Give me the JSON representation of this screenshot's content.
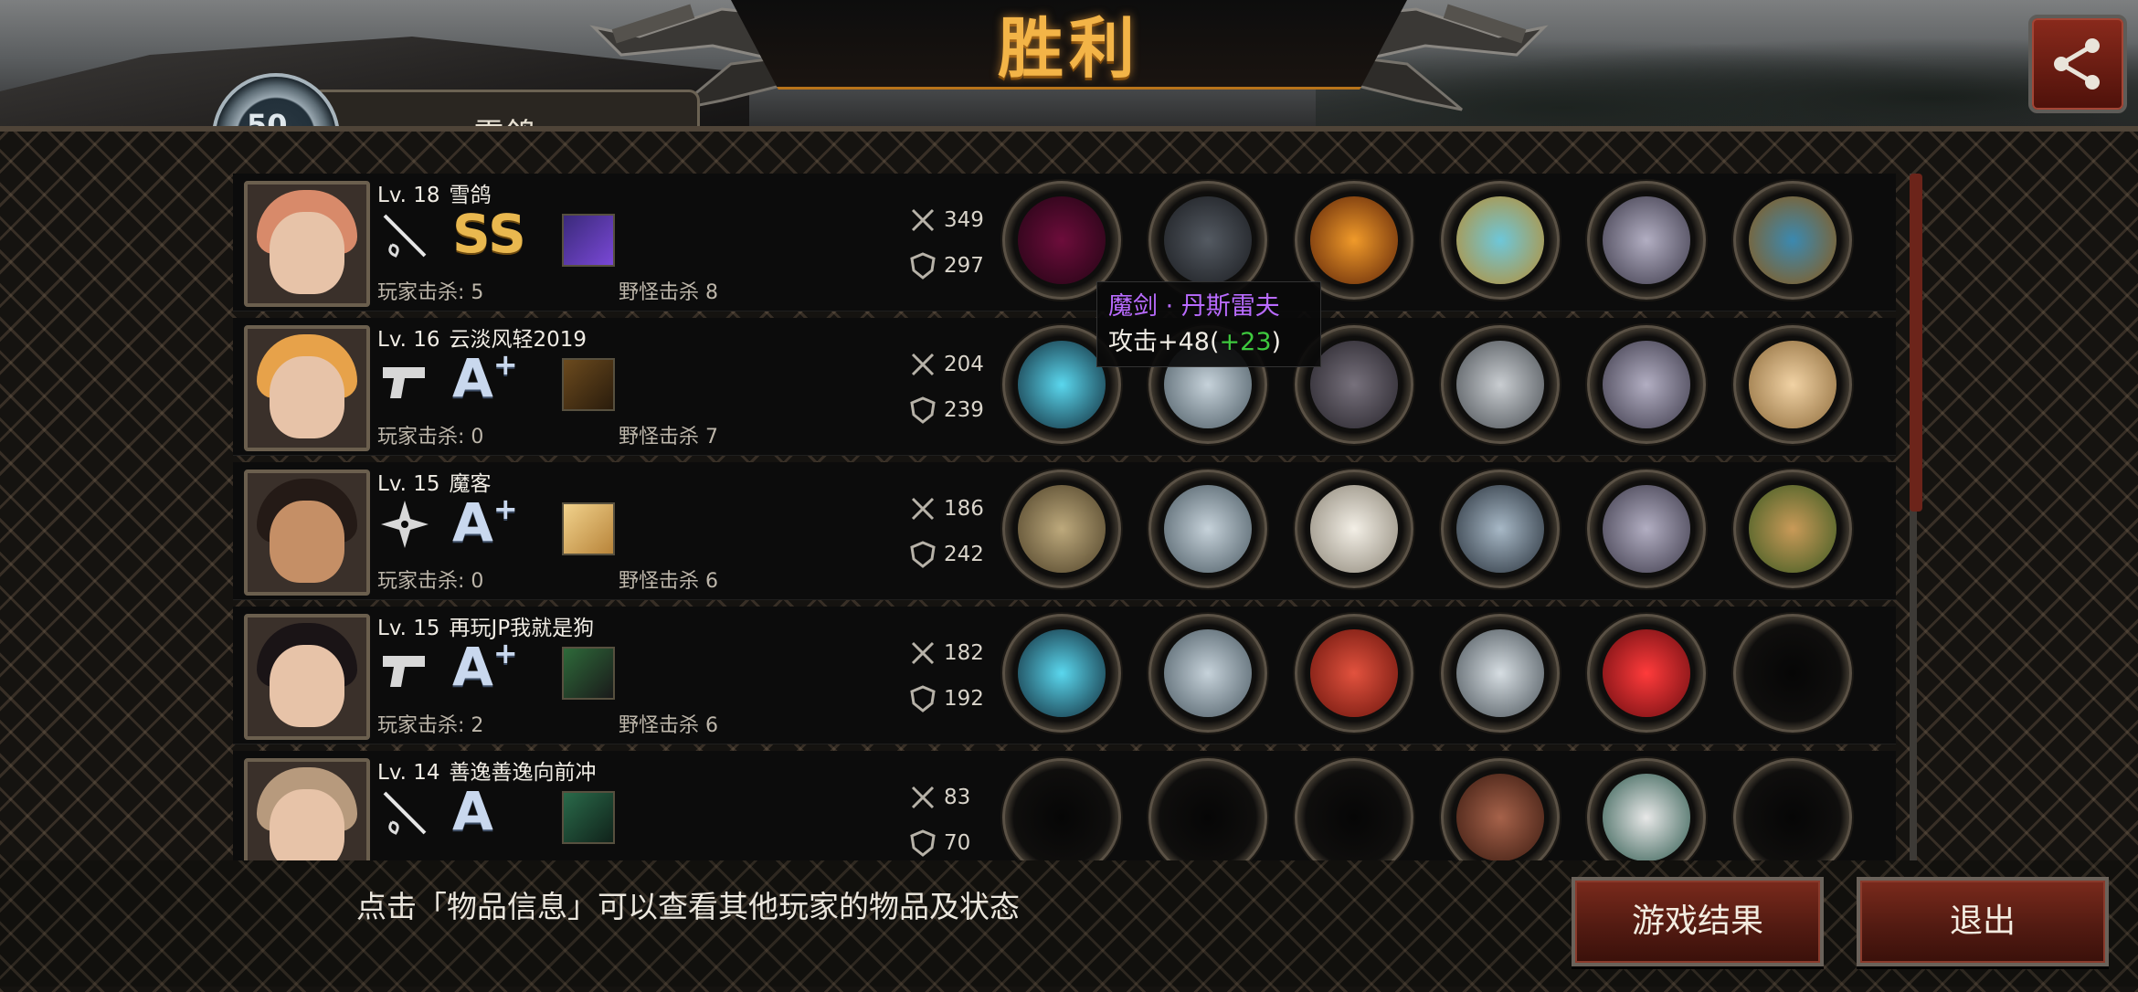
{
  "header": {
    "title": "胜利",
    "emblem_text": "50",
    "team_tab_text": "雪鸽"
  },
  "colors": {
    "title_gold": "#f3b447",
    "button_red": "#7a2a1c",
    "purple_item": "#b96bff",
    "green_bonus": "#3ec93e"
  },
  "players": [
    {
      "level": "Lv. 18",
      "name": "雪鸽",
      "weapon": "rapier-icon",
      "grade": "SS",
      "grade_sup": "",
      "player_kills": "玩家击杀: 5",
      "monster_kills": "野怪击杀 8",
      "attack": "349",
      "defense": "297",
      "items": [
        "magic-sword-icon",
        "dark-helmet-icon",
        "flame-armor-icon",
        "gold-bracelet-icon",
        "silver-boots-icon",
        "earrings-icon"
      ]
    },
    {
      "level": "Lv. 16",
      "name": "云淡风轻2019",
      "weapon": "pistol-icon",
      "grade": "A",
      "grade_sup": "+",
      "player_kills": "玩家击杀: 0",
      "monster_kills": "野怪击杀 7",
      "attack": "204",
      "defense": "239",
      "items": [
        "blue-rifle-icon",
        "steel-helmet-icon",
        "stone-armor-icon",
        "steel-disc-icon",
        "silver-boots-icon",
        "hand-fan-icon"
      ]
    },
    {
      "level": "Lv. 15",
      "name": "魔客",
      "weapon": "shuriken-icon",
      "grade": "A",
      "grade_sup": "+",
      "player_kills": "玩家击杀: 0",
      "monster_kills": "野怪击杀 6",
      "attack": "186",
      "defense": "242",
      "items": [
        "bronze-shield-icon",
        "steel-helmet-icon",
        "white-armor-icon",
        "watch-icon",
        "silver-boots-icon",
        "wooden-box-icon"
      ]
    },
    {
      "level": "Lv. 15",
      "name": "再玩JP我就是狗",
      "weapon": "pistol-icon",
      "grade": "A",
      "grade_sup": "+",
      "player_kills": "玩家击杀: 2",
      "monster_kills": "野怪击杀 6",
      "attack": "182",
      "defense": "192",
      "items": [
        "blue-rifle-icon",
        "steel-helmet-icon",
        "red-shirt-icon",
        "spiked-blade-icon",
        "red-heels-icon",
        "empty-slot"
      ]
    },
    {
      "level": "Lv. 14",
      "name": "善逸善逸向前冲",
      "weapon": "rapier-icon",
      "grade": "A",
      "grade_sup": "",
      "player_kills": "",
      "monster_kills": "",
      "attack": "83",
      "defense": "70",
      "items": [
        "empty-slot",
        "empty-slot",
        "empty-slot",
        "leather-shield-icon",
        "sneaker-icon",
        "empty-slot"
      ]
    }
  ],
  "tooltip": {
    "name": "魔剑 · 丹斯雷夫",
    "stat_prefix": "攻击+48(",
    "stat_bonus": "+23",
    "stat_suffix": ")"
  },
  "footer": {
    "hint": "点击「物品信息」可以查看其他玩家的物品及状态",
    "result_button": "游戏结果",
    "exit_button": "退出"
  }
}
